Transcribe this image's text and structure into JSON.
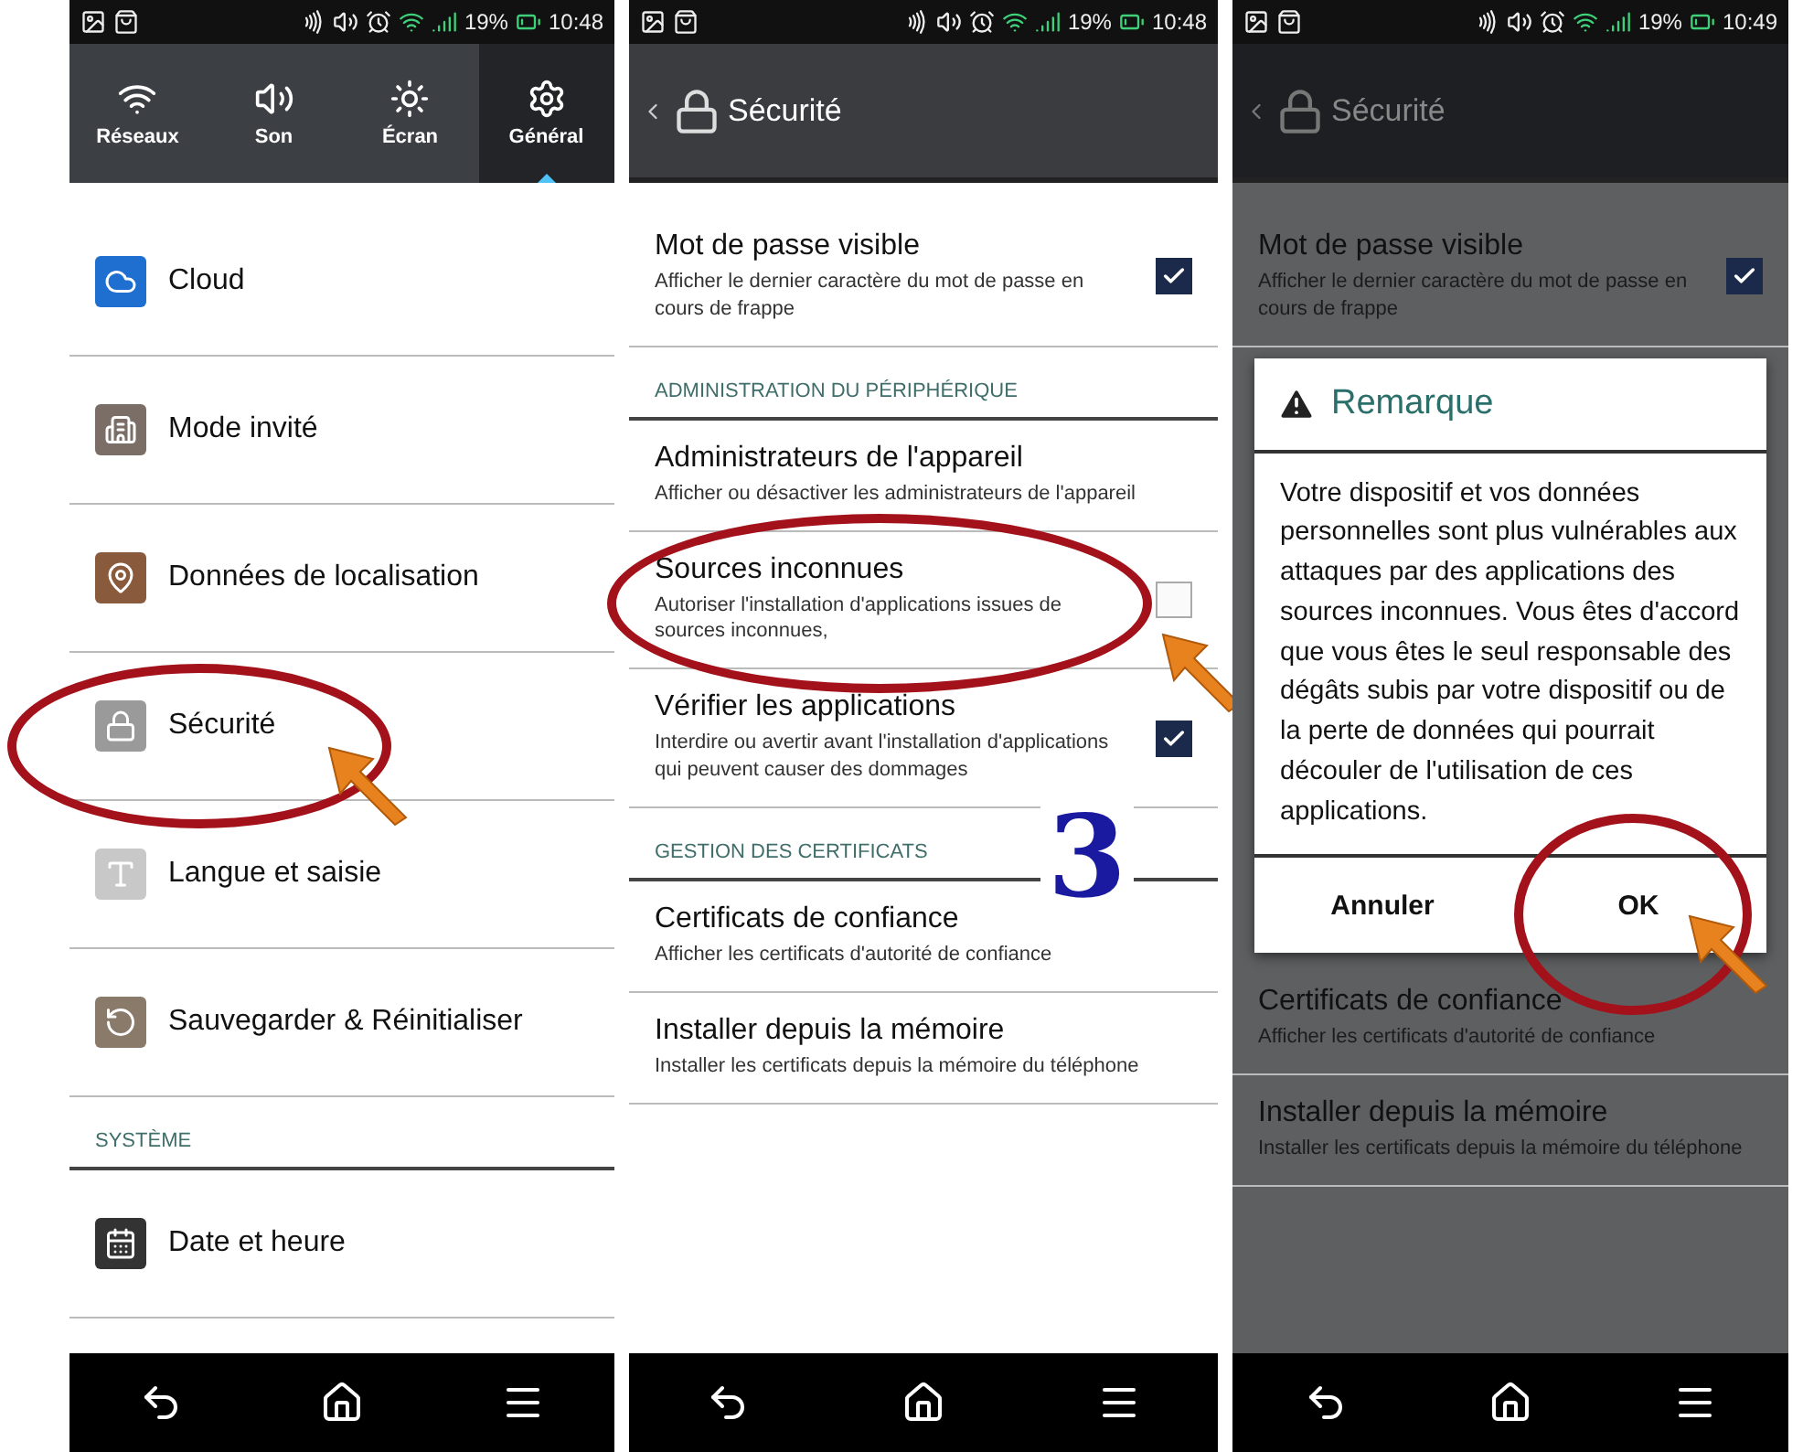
{
  "screens": [
    {
      "kind": "quick_settings",
      "dimmed": false,
      "status_bar": {
        "battery": "19%",
        "time": "10:48"
      },
      "quick_settings": [
        {
          "label": "Réseaux",
          "selected": false
        },
        {
          "label": "Son",
          "selected": false
        },
        {
          "label": "Écran",
          "selected": false
        },
        {
          "label": "Général",
          "selected": true
        }
      ],
      "items": [
        {
          "kind": "entry",
          "label": "Cloud",
          "circled": false
        },
        {
          "kind": "entry",
          "label": "Mode invité",
          "circled": false
        },
        {
          "kind": "entry",
          "label": "Données de localisation",
          "circled": false
        },
        {
          "kind": "entry",
          "label": "Sécurité",
          "circled": true
        },
        {
          "kind": "entry",
          "label": "Langue et saisie",
          "circled": false
        },
        {
          "kind": "entry",
          "label": "Sauvegarder & Réinitialiser",
          "circled": false
        },
        {
          "kind": "section",
          "label": "SYSTÈME"
        },
        {
          "kind": "entry",
          "label": "Date et heure",
          "circled": false
        }
      ]
    },
    {
      "kind": "settings",
      "dimmed": false,
      "status_bar": {
        "battery": "19%",
        "time": "10:48"
      },
      "header": {
        "title": "Sécurité"
      },
      "items": [
        {
          "kind": "setting",
          "label": "Mot de passe visible",
          "description": "Afficher le dernier caractère du mot de passe en cours de frappe",
          "checked": true,
          "circled": false
        },
        {
          "kind": "section",
          "label": "ADMINISTRATION DU PÉRIPHÉRIQUE"
        },
        {
          "kind": "link",
          "label": "Administrateurs de l'appareil",
          "description": "Afficher ou désactiver les administrateurs de l'appareil",
          "circled": false
        },
        {
          "kind": "setting",
          "label": "Sources inconnues",
          "description": "Autoriser l'installation d'applications issues de sources inconnues,",
          "checked": false,
          "circled": true
        },
        {
          "kind": "setting",
          "label": "Vérifier les applications",
          "description": "Interdire ou avertir avant l'installation d'applications qui peuvent causer des dommages",
          "checked": true,
          "circled": false
        },
        {
          "kind": "section",
          "label": "GESTION DES CERTIFICATS",
          "step_label": "3"
        },
        {
          "kind": "link",
          "label": "Certificats de confiance",
          "description": "Afficher les certificats d'autorité de confiance",
          "circled": false
        },
        {
          "kind": "link",
          "label": "Installer depuis la mémoire",
          "description": "Installer les certificats depuis la mémoire du téléphone",
          "circled": false
        }
      ]
    },
    {
      "kind": "settings",
      "dimmed": true,
      "status_bar": {
        "battery": "19%",
        "time": "10:49"
      },
      "header": {
        "title": "Sécurité"
      },
      "items": [
        {
          "kind": "setting",
          "label": "Mot de passe visible",
          "description": "Afficher le dernier caractère du mot de passe en cours de frappe",
          "checked": true,
          "circled": false
        },
        {
          "kind": "dialog",
          "title": "Remarque",
          "message": "Votre dispositif et vos données personnelles sont plus vulnérables aux attaques par des applications des sources inconnues. Vous êtes d'accord que vous êtes le seul responsable des dégâts subis par votre dispositif ou de la perte de données qui pourrait découler de l'utilisation de ces applications.",
          "buttons": [
            {
              "label": "Annuler",
              "circled": false
            },
            {
              "label": "OK",
              "circled": true
            }
          ]
        },
        {
          "kind": "link",
          "label": "Certificats de confiance",
          "description": "Afficher les certificats d'autorité de confiance",
          "circled": false
        },
        {
          "kind": "link",
          "label": "Installer depuis la mémoire",
          "description": "Installer les certificats depuis la mémoire du téléphone",
          "circled": false
        }
      ]
    }
  ]
}
